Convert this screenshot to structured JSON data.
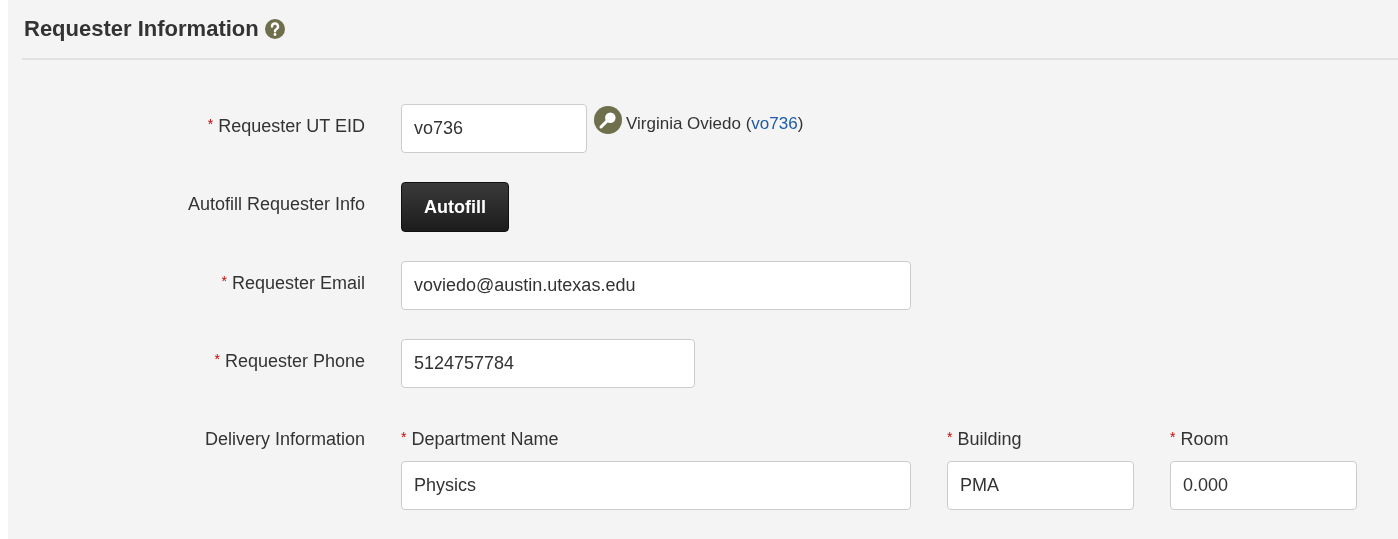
{
  "section": {
    "title": "Requester Information"
  },
  "rows": [
    {
      "kind": "input",
      "label": "Requester UT EID",
      "required_mark": "*",
      "value": "vo736",
      "lookup": {
        "before": "Virginia Oviedo (",
        "link": "vo736",
        "after": ")"
      }
    },
    {
      "kind": "button",
      "label": "Autofill Requester Info",
      "button": "Autofill"
    },
    {
      "kind": "input",
      "label": "Requester Email",
      "required_mark": "*",
      "value": "voviedo@austin.utexas.edu"
    },
    {
      "kind": "input",
      "label": "Requester Phone",
      "required_mark": "*",
      "value": "5124757784"
    },
    {
      "kind": "group",
      "label": "Delivery Information",
      "fields": [
        {
          "label": "Department Name",
          "required_mark": "*",
          "value": "Physics"
        },
        {
          "label": "Building",
          "required_mark": "*",
          "value": "PMA"
        },
        {
          "label": "Room",
          "required_mark": "*",
          "value": "0.000"
        }
      ]
    }
  ]
}
